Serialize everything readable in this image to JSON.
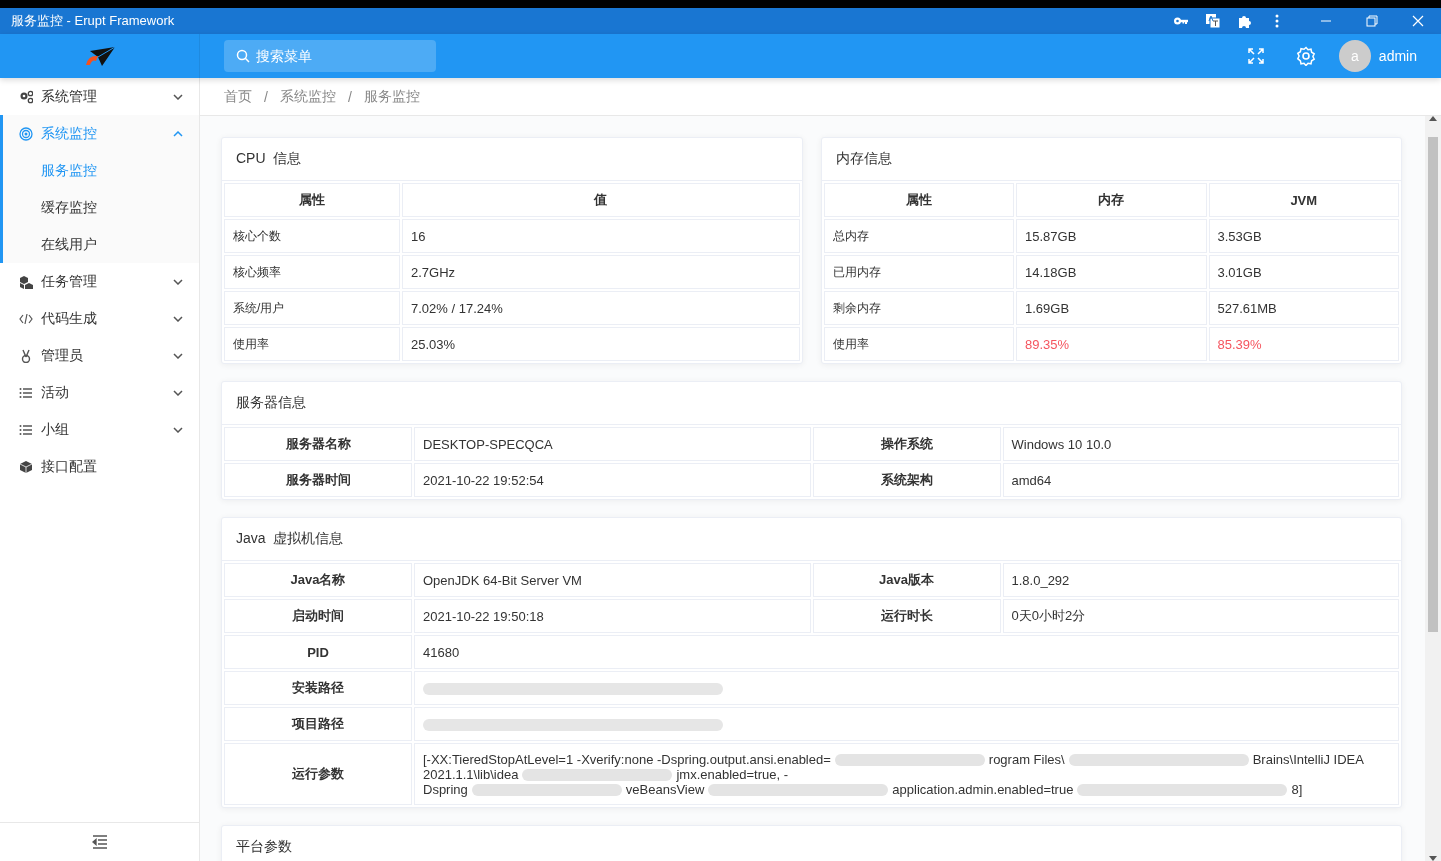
{
  "window": {
    "title": "服务监控 - Erupt Framework"
  },
  "header": {
    "search_placeholder": "搜索菜单",
    "avatar_letter": "a",
    "user_name": "admin"
  },
  "sidebar": {
    "items": [
      {
        "label": "系统管理",
        "kind": "group",
        "expanded": false,
        "selected": false
      },
      {
        "label": "系统监控",
        "kind": "group",
        "expanded": true,
        "selected": true,
        "children": [
          {
            "label": "服务监控",
            "selected": true
          },
          {
            "label": "缓存监控",
            "selected": false
          },
          {
            "label": "在线用户",
            "selected": false
          }
        ]
      },
      {
        "label": "任务管理",
        "kind": "group",
        "expanded": false,
        "selected": false
      },
      {
        "label": "代码生成",
        "kind": "group",
        "expanded": false,
        "selected": false
      },
      {
        "label": "管理员",
        "kind": "group",
        "expanded": false,
        "selected": false
      },
      {
        "label": "活动",
        "kind": "group",
        "expanded": false,
        "selected": false
      },
      {
        "label": "小组",
        "kind": "group",
        "expanded": false,
        "selected": false
      },
      {
        "label": "接口配置",
        "kind": "link",
        "expanded": false,
        "selected": false
      }
    ]
  },
  "breadcrumb": {
    "separator": "/",
    "items": [
      "首页",
      "系统监控",
      "服务监控"
    ]
  },
  "cpu": {
    "title": "CPU  信息",
    "columns": [
      "属性",
      "值"
    ],
    "rows": [
      [
        "核心个数",
        "16"
      ],
      [
        "核心频率",
        "2.7GHz"
      ],
      [
        "系统/用户",
        "7.02% / 17.24%"
      ],
      [
        "使用率",
        "25.03%"
      ]
    ]
  },
  "memory": {
    "title": "内存信息",
    "columns": [
      "属性",
      "内存",
      "JVM"
    ],
    "rows": [
      [
        {
          "text": "总内存",
          "warn": false
        },
        {
          "text": "15.87GB",
          "warn": false
        },
        {
          "text": "3.53GB",
          "warn": false
        }
      ],
      [
        {
          "text": "已用内存",
          "warn": false
        },
        {
          "text": "14.18GB",
          "warn": false
        },
        {
          "text": "3.01GB",
          "warn": false
        }
      ],
      [
        {
          "text": "剩余内存",
          "warn": false
        },
        {
          "text": "1.69GB",
          "warn": false
        },
        {
          "text": "527.61MB",
          "warn": false
        }
      ],
      [
        {
          "text": "使用率",
          "warn": false
        },
        {
          "text": "89.35%",
          "warn": true
        },
        {
          "text": "85.39%",
          "warn": true
        }
      ]
    ]
  },
  "server": {
    "title": "服务器信息",
    "rows": [
      [
        {
          "label": "服务器名称",
          "value": "DESKTOP-SPECQCA"
        },
        {
          "label": "操作系统",
          "value": "Windows 10 10.0"
        }
      ],
      [
        {
          "label": "服务器时间",
          "value": "2021-10-22 19:52:54"
        },
        {
          "label": "系统架构",
          "value": "amd64"
        }
      ]
    ]
  },
  "jvm": {
    "title": "Java  虚拟机信息",
    "rows": [
      [
        {
          "label": "Java名称",
          "value": "OpenJDK 64-Bit Server VM"
        },
        {
          "label": "Java版本",
          "value": "1.8.0_292"
        }
      ],
      [
        {
          "label": "启动时间",
          "value": "2021-10-22 19:50:18"
        },
        {
          "label": "运行时长",
          "value": "0天0小时2分"
        }
      ],
      [
        {
          "label": "PID",
          "value": "41680"
        }
      ],
      [
        {
          "label": "安装路径",
          "redacted": true
        }
      ],
      [
        {
          "label": "项目路径",
          "redacted": true
        }
      ],
      [
        {
          "label": "运行参数",
          "lines": [
            [
              "[-XX:TieredStopAtLevel=1 -Xverify:none -Dspring.output.ansi.enabled=",
              "rogram Files\\",
              "Brains\\IntelliJ IDEA"
            ],
            [
              "2021.1.1\\lib\\idea",
              "jmx.enabled=true, -"
            ],
            [
              "Dspring",
              "veBeansView",
              "application.admin.enabled=true",
              "8]"
            ]
          ]
        }
      ]
    ]
  },
  "platform": {
    "title": "平台参数"
  }
}
